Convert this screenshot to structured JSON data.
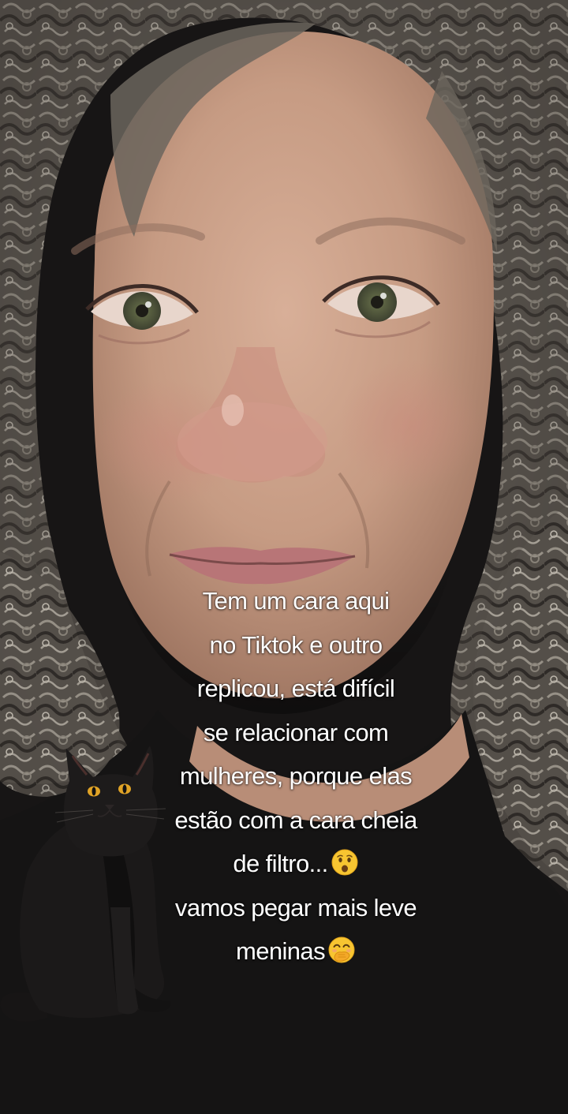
{
  "caption": {
    "lines": [
      "Tem um cara aqui",
      "no Tiktok e outro",
      "replicou, está difícil",
      "se relacionar com",
      "mulheres, porque elas",
      "estão com a cara cheia",
      "de filtro...",
      "vamos pegar mais leve",
      "meninas"
    ]
  },
  "icons": {
    "line_7_emoji": "hushed-face-emoji",
    "line_9_emoji": "face-with-hand-over-mouth-emoji"
  },
  "colors": {
    "caption_text": "#ffffff",
    "background": "#141212",
    "skin": "#c99f88",
    "hair": "#6d6861",
    "shirt": "#141313",
    "cat": "#1b1919",
    "cat_eyes": "#e0a326"
  }
}
